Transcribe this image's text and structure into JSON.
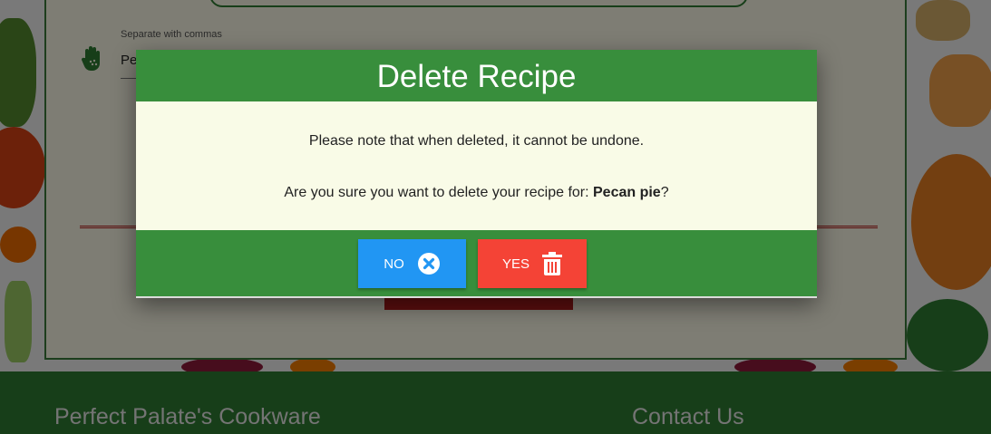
{
  "form": {
    "hint": "Separate with commas",
    "field_value": "Pec"
  },
  "footer": {
    "left_title": "Perfect Palate's Cookware",
    "right_title": "Contact Us"
  },
  "modal": {
    "title": "Delete Recipe",
    "note": "Please note that when deleted, it cannot be undone.",
    "question_prefix": "Are you sure you want to delete your recipe for: ",
    "recipe_name": "Pecan pie",
    "question_suffix": "?",
    "no_label": "NO",
    "yes_label": "YES",
    "no_icon": "close-circle-icon",
    "yes_icon": "trash-icon"
  },
  "colors": {
    "header_green": "#388e3c",
    "body_cream": "#f9fbe7",
    "no_blue": "#2196f3",
    "yes_red": "#f44336",
    "footer_green": "#2e7d32"
  }
}
